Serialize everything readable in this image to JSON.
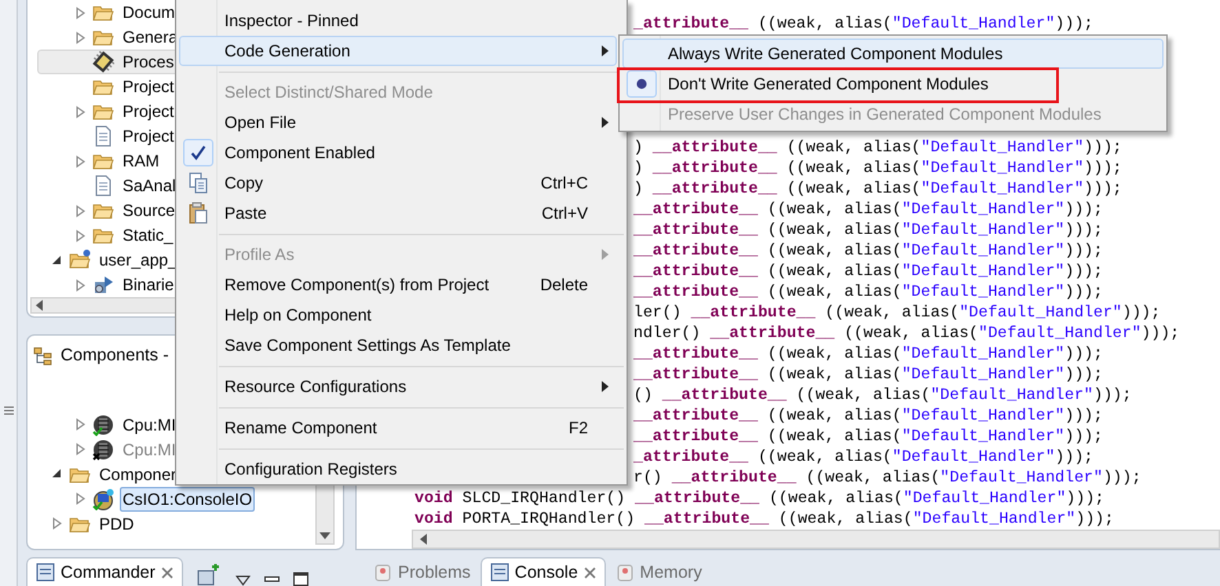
{
  "project_tree": {
    "items": [
      {
        "children": [
          {
            "label": "Docum",
            "kind": "folder",
            "expanded": false,
            "selected": false
          },
          {
            "label": "Genera",
            "kind": "folder",
            "expanded": false,
            "selected": false
          },
          {
            "label": "Proces",
            "kind": "chip",
            "selected": true
          },
          {
            "label": "Project",
            "kind": "folder",
            "selected": false
          },
          {
            "label": "Project",
            "kind": "folder",
            "expanded": false,
            "selected": false
          },
          {
            "label": "Project",
            "kind": "file",
            "selected": false
          },
          {
            "label": "RAM",
            "kind": "folder",
            "expanded": false,
            "selected": false
          },
          {
            "label": "SaAnal",
            "kind": "file",
            "selected": false
          },
          {
            "label": "Source",
            "kind": "folder",
            "expanded": false,
            "selected": false
          },
          {
            "label": "Static_",
            "kind": "folder",
            "expanded": false,
            "selected": false
          }
        ]
      },
      {
        "label": "user_app_",
        "kind": "project",
        "expanded": true,
        "selected": false,
        "children": [
          {
            "label": "Binarie",
            "kind": "binaries",
            "expanded": false,
            "selected": false
          }
        ]
      }
    ]
  },
  "components_panel": {
    "title": "Components -",
    "items": [
      {
        "children": [
          {
            "label": "Cpu:MI",
            "kind": "cpu",
            "expanded": false,
            "selected": false,
            "disabled": false
          },
          {
            "label": "Cpu:MI",
            "kind": "cpu",
            "expanded": false,
            "selected": false,
            "disabled": true
          }
        ]
      },
      {
        "label": "Componer",
        "kind": "folder",
        "expanded": true,
        "selected": false,
        "disabled": false,
        "children": [
          {
            "label": "CsIO1:ConsoleIO",
            "kind": "component",
            "expanded": false,
            "selected": true,
            "disabled": false
          }
        ]
      },
      {
        "label": "PDD",
        "kind": "folder",
        "expanded": false,
        "selected": false,
        "disabled": false
      }
    ]
  },
  "editor": {
    "above_submenu": [
      {
        "kind": "fragment",
        "parts": [
          {
            "kind": "keyword",
            "text": "_attribute__"
          },
          {
            "kind": "plain",
            "text": " ((weak, alias("
          },
          {
            "kind": "string",
            "text": "\"Default_Handler\""
          },
          {
            "kind": "plain",
            "text": ")));"
          }
        ]
      }
    ],
    "below_submenu": [
      {
        "kind": "fragment",
        "parts": [
          {
            "kind": "plain",
            "text": ") "
          },
          {
            "kind": "keyword",
            "text": "__attribute__"
          },
          {
            "kind": "plain",
            "text": " ((weak, alias("
          },
          {
            "kind": "string",
            "text": "\"Default_Handler\""
          },
          {
            "kind": "plain",
            "text": ")));"
          }
        ]
      },
      {
        "kind": "fragment",
        "parts": [
          {
            "kind": "plain",
            "text": ") "
          },
          {
            "kind": "keyword",
            "text": "__attribute__"
          },
          {
            "kind": "plain",
            "text": " ((weak, alias("
          },
          {
            "kind": "string",
            "text": "\"Default_Handler\""
          },
          {
            "kind": "plain",
            "text": ")));"
          }
        ]
      },
      {
        "kind": "fragment",
        "parts": [
          {
            "kind": "plain",
            "text": ") "
          },
          {
            "kind": "keyword",
            "text": "__attribute__"
          },
          {
            "kind": "plain",
            "text": " ((weak, alias("
          },
          {
            "kind": "string",
            "text": "\"Default_Handler\""
          },
          {
            "kind": "plain",
            "text": ")));"
          }
        ]
      },
      {
        "kind": "fragment",
        "parts": [
          {
            "kind": "keyword",
            "text": "__attribute__"
          },
          {
            "kind": "plain",
            "text": " ((weak, alias("
          },
          {
            "kind": "string",
            "text": "\"Default_Handler\""
          },
          {
            "kind": "plain",
            "text": ")));"
          }
        ]
      },
      {
        "kind": "fragment",
        "parts": [
          {
            "kind": "keyword",
            "text": "__attribute__"
          },
          {
            "kind": "plain",
            "text": " ((weak, alias("
          },
          {
            "kind": "string",
            "text": "\"Default_Handler\""
          },
          {
            "kind": "plain",
            "text": ")));"
          }
        ]
      },
      {
        "kind": "fragment",
        "parts": [
          {
            "kind": "keyword",
            "text": "__attribute__"
          },
          {
            "kind": "plain",
            "text": " ((weak, alias("
          },
          {
            "kind": "string",
            "text": "\"Default_Handler\""
          },
          {
            "kind": "plain",
            "text": ")));"
          }
        ]
      },
      {
        "kind": "fragment",
        "parts": [
          {
            "kind": "keyword",
            "text": "__attribute__"
          },
          {
            "kind": "plain",
            "text": " ((weak, alias("
          },
          {
            "kind": "string",
            "text": "\"Default_Handler\""
          },
          {
            "kind": "plain",
            "text": ")));"
          }
        ]
      },
      {
        "kind": "fragment",
        "parts": [
          {
            "kind": "keyword",
            "text": "__attribute__"
          },
          {
            "kind": "plain",
            "text": " ((weak, alias("
          },
          {
            "kind": "string",
            "text": "\"Default_Handler\""
          },
          {
            "kind": "plain",
            "text": ")));"
          }
        ]
      },
      {
        "kind": "fragment",
        "parts": [
          {
            "kind": "plain",
            "text": "ler() "
          },
          {
            "kind": "keyword",
            "text": "__attribute__"
          },
          {
            "kind": "plain",
            "text": " ((weak, alias("
          },
          {
            "kind": "string",
            "text": "\"Default_Handler\""
          },
          {
            "kind": "plain",
            "text": ")));"
          }
        ]
      },
      {
        "kind": "fragment",
        "parts": [
          {
            "kind": "plain",
            "text": "ndler() "
          },
          {
            "kind": "keyword",
            "text": "__attribute__"
          },
          {
            "kind": "plain",
            "text": " ((weak, alias("
          },
          {
            "kind": "string",
            "text": "\"Default_Handler\""
          },
          {
            "kind": "plain",
            "text": ")));"
          }
        ]
      },
      {
        "kind": "fragment",
        "parts": [
          {
            "kind": "keyword",
            "text": "__attribute__"
          },
          {
            "kind": "plain",
            "text": " ((weak, alias("
          },
          {
            "kind": "string",
            "text": "\"Default_Handler\""
          },
          {
            "kind": "plain",
            "text": ")));"
          }
        ]
      },
      {
        "kind": "fragment",
        "parts": [
          {
            "kind": "keyword",
            "text": "__attribute__"
          },
          {
            "kind": "plain",
            "text": " ((weak, alias("
          },
          {
            "kind": "string",
            "text": "\"Default_Handler\""
          },
          {
            "kind": "plain",
            "text": ")));"
          }
        ]
      },
      {
        "kind": "fragment",
        "parts": [
          {
            "kind": "plain",
            "text": "() "
          },
          {
            "kind": "keyword",
            "text": "__attribute__"
          },
          {
            "kind": "plain",
            "text": " ((weak, alias("
          },
          {
            "kind": "string",
            "text": "\"Default_Handler\""
          },
          {
            "kind": "plain",
            "text": ")));"
          }
        ]
      },
      {
        "kind": "fragment",
        "parts": [
          {
            "kind": "keyword",
            "text": "__attribute__"
          },
          {
            "kind": "plain",
            "text": " ((weak, alias("
          },
          {
            "kind": "string",
            "text": "\"Default_Handler\""
          },
          {
            "kind": "plain",
            "text": ")));"
          }
        ]
      },
      {
        "kind": "fragment",
        "parts": [
          {
            "kind": "keyword",
            "text": "__attribute__"
          },
          {
            "kind": "plain",
            "text": " ((weak, alias("
          },
          {
            "kind": "string",
            "text": "\"Default_Handler\""
          },
          {
            "kind": "plain",
            "text": ")));"
          }
        ]
      },
      {
        "kind": "fragment",
        "parts": [
          {
            "kind": "keyword",
            "text": "_attribute__"
          },
          {
            "kind": "plain",
            "text": " ((weak, alias("
          },
          {
            "kind": "string",
            "text": "\"Default_Handler\""
          },
          {
            "kind": "plain",
            "text": ")));"
          }
        ]
      },
      {
        "kind": "fragment",
        "parts": [
          {
            "kind": "plain",
            "text": "r() "
          },
          {
            "kind": "keyword",
            "text": "__attribute__"
          },
          {
            "kind": "plain",
            "text": " ((weak, alias("
          },
          {
            "kind": "string",
            "text": "\"Default_Handler\""
          },
          {
            "kind": "plain",
            "text": ")));"
          }
        ]
      },
      {
        "kind": "line",
        "parts": [
          {
            "kind": "keyword",
            "text": "void"
          },
          {
            "kind": "plain",
            "text": " SLCD_IRQHandler() "
          },
          {
            "kind": "keyword",
            "text": "__attribute__"
          },
          {
            "kind": "plain",
            "text": " ((weak, alias("
          },
          {
            "kind": "string",
            "text": "\"Default_Handler\""
          },
          {
            "kind": "plain",
            "text": ")));"
          }
        ]
      },
      {
        "kind": "line",
        "parts": [
          {
            "kind": "keyword",
            "text": "void"
          },
          {
            "kind": "plain",
            "text": " PORTA_IRQHandler() "
          },
          {
            "kind": "keyword",
            "text": "__attribute__"
          },
          {
            "kind": "plain",
            "text": " ((weak, alias("
          },
          {
            "kind": "string",
            "text": "\"Default_Handler\""
          },
          {
            "kind": "plain",
            "text": ")));"
          }
        ]
      }
    ]
  },
  "context_menu": {
    "items": [
      {
        "kind": "item",
        "label": "Inspector - Pinned",
        "selected": false,
        "disabled": false,
        "checked": false,
        "submenu": false
      },
      {
        "kind": "item",
        "label": "Code Generation",
        "selected": true,
        "disabled": false,
        "checked": false,
        "submenu": true
      },
      {
        "kind": "separator"
      },
      {
        "kind": "item",
        "label": "Select Distinct/Shared Mode",
        "selected": false,
        "disabled": true,
        "checked": false,
        "submenu": false
      },
      {
        "kind": "item",
        "label": "Open File",
        "selected": false,
        "disabled": false,
        "checked": false,
        "submenu": true
      },
      {
        "kind": "item",
        "label": "Component Enabled",
        "selected": false,
        "disabled": false,
        "checked": true,
        "submenu": false
      },
      {
        "kind": "copy",
        "label": "Copy",
        "shortcut": "Ctrl+C",
        "selected": false,
        "disabled": false,
        "checked": false,
        "submenu": false
      },
      {
        "kind": "paste",
        "label": "Paste",
        "shortcut": "Ctrl+V",
        "selected": false,
        "disabled": false,
        "checked": false,
        "submenu": false
      },
      {
        "kind": "separator"
      },
      {
        "kind": "item",
        "label": "Profile As",
        "selected": false,
        "disabled": true,
        "checked": false,
        "submenu": true
      },
      {
        "kind": "item",
        "label": "Remove Component(s) from Project",
        "shortcut": "Delete",
        "selected": false,
        "disabled": false,
        "checked": false,
        "submenu": false
      },
      {
        "kind": "item",
        "label": "Help on Component",
        "selected": false,
        "disabled": false,
        "checked": false,
        "submenu": false
      },
      {
        "kind": "item",
        "label": "Save Component Settings As Template",
        "selected": false,
        "disabled": false,
        "checked": false,
        "submenu": false
      },
      {
        "kind": "separator"
      },
      {
        "kind": "item",
        "label": "Resource Configurations",
        "selected": false,
        "disabled": false,
        "checked": false,
        "submenu": true
      },
      {
        "kind": "separator"
      },
      {
        "kind": "item",
        "label": "Rename Component",
        "shortcut": "F2",
        "selected": false,
        "disabled": false,
        "checked": false,
        "submenu": false
      },
      {
        "kind": "separator"
      },
      {
        "kind": "item",
        "label": "Configuration Registers",
        "selected": false,
        "disabled": false,
        "checked": false,
        "submenu": false
      }
    ]
  },
  "submenu": {
    "items": [
      {
        "label": "Always Write Generated Component Modules",
        "selected": true,
        "checked": false,
        "disabled": false,
        "outlined": false
      },
      {
        "label": "Don't Write Generated Component Modules",
        "selected": false,
        "checked": true,
        "disabled": false,
        "outlined": true
      },
      {
        "label": "Preserve User Changes in Generated Component Modules",
        "selected": false,
        "checked": false,
        "disabled": true,
        "outlined": false
      }
    ]
  },
  "left_bottom_tabs": [
    {
      "label": "Commander",
      "selected": true,
      "closable": true
    }
  ],
  "editor_bottom_tabs": [
    {
      "label": "Problems",
      "selected": false,
      "closable": false
    },
    {
      "label": "Console",
      "selected": true,
      "closable": true
    },
    {
      "label": "Memory",
      "selected": false,
      "closable": false
    }
  ]
}
